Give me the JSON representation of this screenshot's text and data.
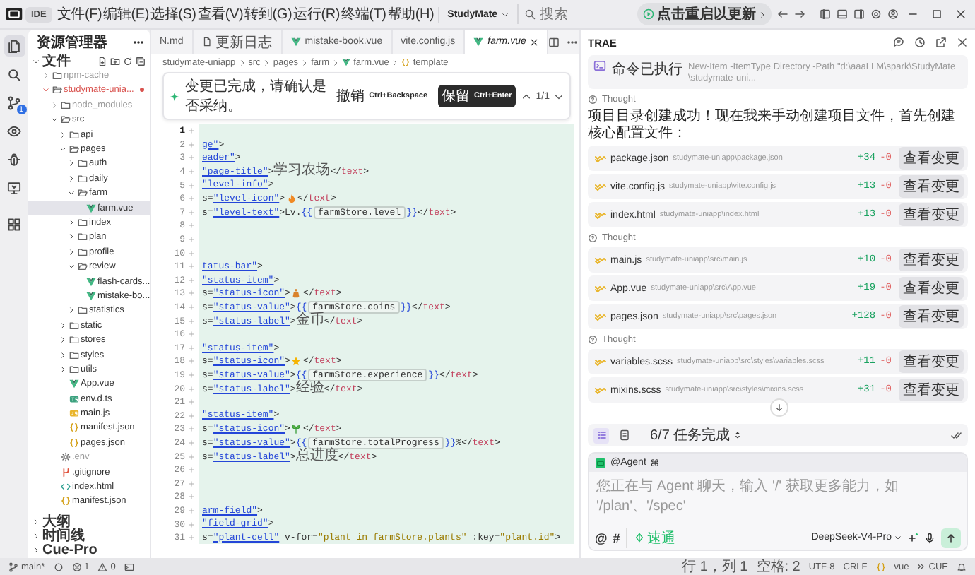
{
  "titlebar": {
    "ide_label": "IDE",
    "menus": [
      "文件(F)",
      "编辑(E)",
      "选择(S)",
      "查看(V)",
      "转到(G)",
      "运行(R)",
      "终端(T)",
      "帮助(H)"
    ],
    "project": "StudyMate",
    "search": {
      "placeholder": "搜索"
    },
    "update_button": "点击重启以更新"
  },
  "activity_bar": [
    {
      "kind": "files",
      "selected": true
    },
    {
      "kind": "search",
      "selected": false
    },
    {
      "kind": "source-control",
      "selected": false,
      "badge": "1"
    },
    {
      "kind": "preview",
      "selected": false
    },
    {
      "kind": "debug",
      "selected": false
    },
    {
      "kind": "remote",
      "selected": false
    },
    {
      "kind": "extensions",
      "selected": false
    }
  ],
  "explorer": {
    "title": "资源管理器",
    "section": {
      "label": "文件",
      "expanded": true
    },
    "tree": [
      {
        "label": "npm-cache",
        "kind": "folder",
        "expanded": false,
        "selected": false,
        "modified": false,
        "color": "#9a9a9a"
      },
      {
        "label": "studymate-unia...",
        "kind": "folder",
        "expanded": true,
        "selected": false,
        "modified": true,
        "color": "#d9534f",
        "children": [
          {
            "label": "node_modules",
            "kind": "folder",
            "expanded": false,
            "selected": false,
            "color": "#9a9a9a"
          },
          {
            "label": "src",
            "kind": "folder",
            "expanded": true,
            "selected": false,
            "children": [
              {
                "label": "api",
                "kind": "folder",
                "expanded": false,
                "selected": false
              },
              {
                "label": "pages",
                "kind": "folder",
                "expanded": true,
                "selected": false,
                "children": [
                  {
                    "label": "auth",
                    "kind": "folder",
                    "expanded": false,
                    "selected": false
                  },
                  {
                    "label": "daily",
                    "kind": "folder",
                    "expanded": false,
                    "selected": false
                  },
                  {
                    "label": "farm",
                    "kind": "folder",
                    "expanded": true,
                    "selected": false,
                    "children": [
                      {
                        "label": "farm.vue",
                        "kind": "vue",
                        "selected": true
                      }
                    ]
                  },
                  {
                    "label": "index",
                    "kind": "folder",
                    "expanded": false,
                    "selected": false
                  },
                  {
                    "label": "plan",
                    "kind": "folder",
                    "expanded": false,
                    "selected": false
                  },
                  {
                    "label": "profile",
                    "kind": "folder",
                    "expanded": false,
                    "selected": false
                  },
                  {
                    "label": "review",
                    "kind": "folder",
                    "expanded": true,
                    "selected": false,
                    "children": [
                      {
                        "label": "flash-cards...",
                        "kind": "vue",
                        "selected": false
                      },
                      {
                        "label": "mistake-bo...",
                        "kind": "vue",
                        "selected": false
                      }
                    ]
                  },
                  {
                    "label": "statistics",
                    "kind": "folder",
                    "expanded": false,
                    "selected": false
                  }
                ]
              },
              {
                "label": "static",
                "kind": "folder",
                "expanded": false,
                "selected": false
              },
              {
                "label": "stores",
                "kind": "folder",
                "expanded": false,
                "selected": false
              },
              {
                "label": "styles",
                "kind": "folder",
                "expanded": false,
                "selected": false
              },
              {
                "label": "utils",
                "kind": "folder",
                "expanded": false,
                "selected": false
              },
              {
                "label": "App.vue",
                "kind": "vue",
                "selected": false
              },
              {
                "label": "env.d.ts",
                "kind": "ts",
                "selected": false
              },
              {
                "label": "main.js",
                "kind": "js",
                "selected": false
              },
              {
                "label": "manifest.json",
                "kind": "json",
                "selected": false
              },
              {
                "label": "pages.json",
                "kind": "json",
                "selected": false
              }
            ]
          },
          {
            "label": ".env",
            "kind": "env",
            "selected": false,
            "color": "#9a9a9a"
          },
          {
            "label": ".gitignore",
            "kind": "git",
            "selected": false
          },
          {
            "label": "index.html",
            "kind": "html",
            "selected": false
          },
          {
            "label": "manifest.json",
            "kind": "json",
            "selected": false
          }
        ]
      }
    ],
    "panels": [
      {
        "label": "大纲",
        "expanded": false
      },
      {
        "label": "时间线",
        "expanded": false
      },
      {
        "label": "Cue-Pro",
        "expanded": false
      }
    ]
  },
  "editor": {
    "tabs": [
      {
        "label": "N.md",
        "kind": "partial",
        "selected": false
      },
      {
        "label": "更新日志",
        "kind": "doc",
        "selected": false
      },
      {
        "label": "mistake-book.vue",
        "kind": "vue",
        "selected": false
      },
      {
        "label": "vite.config.js",
        "kind": "plain",
        "selected": false
      },
      {
        "label": "farm.vue",
        "kind": "vue",
        "selected": true
      }
    ],
    "breadcrumb": [
      {
        "label": "studymate-uniapp",
        "kind": "folder"
      },
      {
        "label": "src",
        "kind": "folder"
      },
      {
        "label": "pages",
        "kind": "folder"
      },
      {
        "label": "farm",
        "kind": "folder"
      },
      {
        "label": "farm.vue",
        "kind": "vue"
      },
      {
        "label": "template",
        "kind": "braces"
      }
    ],
    "review_bar": {
      "message": "变更已完成，请确认是否采纳。",
      "undo": {
        "label": "撤销",
        "shortcut": "Ctrl+Backspace"
      },
      "keep": {
        "label": "保留",
        "shortcut": "Ctrl+Enter"
      },
      "counter": "1/1"
    },
    "lines": [
      {
        "n": "1",
        "current": true
      },
      {
        "n": "2",
        "current": false,
        "tokens": [
          {
            "kind": "attr",
            "text": "ge\""
          },
          {
            "kind": "plain",
            "text": ">"
          }
        ]
      },
      {
        "n": "3",
        "current": false,
        "tokens": [
          {
            "kind": "attr",
            "text": "eader\""
          },
          {
            "kind": "plain",
            "text": ">"
          }
        ]
      },
      {
        "n": "4",
        "current": false,
        "tokens": [
          {
            "kind": "attr",
            "text": "\"page-title\""
          },
          {
            "kind": "plain",
            "text": ">"
          },
          {
            "kind": "text",
            "text": "学习农场"
          },
          {
            "kind": "plain",
            "text": "</"
          },
          {
            "kind": "tag",
            "text": "text"
          },
          {
            "kind": "plain",
            "text": ">"
          }
        ]
      },
      {
        "n": "5",
        "current": false,
        "tokens": [
          {
            "kind": "attr",
            "text": "\"level-info\""
          },
          {
            "kind": "plain",
            "text": ">"
          }
        ]
      },
      {
        "n": "6",
        "current": false,
        "tokens": [
          {
            "kind": "plain",
            "text": "s="
          },
          {
            "kind": "attr",
            "text": "\"level-icon\""
          },
          {
            "kind": "plain",
            "text": ">"
          },
          {
            "kind": "flame"
          },
          {
            "kind": "plain",
            "text": "</"
          },
          {
            "kind": "tag",
            "text": "text"
          },
          {
            "kind": "plain",
            "text": ">"
          }
        ]
      },
      {
        "n": "7",
        "current": false,
        "tokens": [
          {
            "kind": "plain",
            "text": "s="
          },
          {
            "kind": "attr",
            "text": "\"level-text\""
          },
          {
            "kind": "plain",
            "text": ">Lv."
          },
          {
            "kind": "brace",
            "text": "{{"
          },
          {
            "kind": "expr",
            "text": "farmStore.level"
          },
          {
            "kind": "brace",
            "text": "}}"
          },
          {
            "kind": "plain",
            "text": "</"
          },
          {
            "kind": "tag",
            "text": "text"
          },
          {
            "kind": "plain",
            "text": ">"
          }
        ]
      },
      {
        "n": "8",
        "current": false
      },
      {
        "n": "9",
        "current": false
      },
      {
        "n": "10",
        "current": false
      },
      {
        "n": "11",
        "current": false,
        "tokens": [
          {
            "kind": "attr",
            "text": "tatus-bar\""
          },
          {
            "kind": "plain",
            "text": ">"
          }
        ]
      },
      {
        "n": "12",
        "current": false,
        "tokens": [
          {
            "kind": "attr",
            "text": "\"status-item\""
          },
          {
            "kind": "plain",
            "text": ">"
          }
        ]
      },
      {
        "n": "13",
        "current": false,
        "tokens": [
          {
            "kind": "plain",
            "text": "s="
          },
          {
            "kind": "attr",
            "text": "\"status-icon\""
          },
          {
            "kind": "plain",
            "text": ">"
          },
          {
            "kind": "bag"
          },
          {
            "kind": "plain",
            "text": "</"
          },
          {
            "kind": "tag",
            "text": "text"
          },
          {
            "kind": "plain",
            "text": ">"
          }
        ]
      },
      {
        "n": "14",
        "current": false,
        "tokens": [
          {
            "kind": "plain",
            "text": "s="
          },
          {
            "kind": "attr",
            "text": "\"status-value\""
          },
          {
            "kind": "plain",
            "text": ">"
          },
          {
            "kind": "brace",
            "text": "{{"
          },
          {
            "kind": "expr",
            "text": "farmStore.coins"
          },
          {
            "kind": "brace",
            "text": "}}"
          },
          {
            "kind": "plain",
            "text": "</"
          },
          {
            "kind": "tag",
            "text": "text"
          },
          {
            "kind": "plain",
            "text": ">"
          }
        ]
      },
      {
        "n": "15",
        "current": false,
        "tokens": [
          {
            "kind": "plain",
            "text": "s="
          },
          {
            "kind": "attr",
            "text": "\"status-label\""
          },
          {
            "kind": "plain",
            "text": ">"
          },
          {
            "kind": "text",
            "text": "金币"
          },
          {
            "kind": "plain",
            "text": "</"
          },
          {
            "kind": "tag",
            "text": "text"
          },
          {
            "kind": "plain",
            "text": ">"
          }
        ]
      },
      {
        "n": "16",
        "current": false
      },
      {
        "n": "17",
        "current": false,
        "tokens": [
          {
            "kind": "attr",
            "text": "\"status-item\""
          },
          {
            "kind": "plain",
            "text": ">"
          }
        ]
      },
      {
        "n": "18",
        "current": false,
        "tokens": [
          {
            "kind": "plain",
            "text": "s="
          },
          {
            "kind": "attr",
            "text": "\"status-icon\""
          },
          {
            "kind": "plain",
            "text": ">"
          },
          {
            "kind": "star"
          },
          {
            "kind": "plain",
            "text": "</"
          },
          {
            "kind": "tag",
            "text": "text"
          },
          {
            "kind": "plain",
            "text": ">"
          }
        ]
      },
      {
        "n": "19",
        "current": false,
        "tokens": [
          {
            "kind": "plain",
            "text": "s="
          },
          {
            "kind": "attr",
            "text": "\"status-value\""
          },
          {
            "kind": "plain",
            "text": ">"
          },
          {
            "kind": "brace",
            "text": "{{"
          },
          {
            "kind": "expr",
            "text": "farmStore.experience"
          },
          {
            "kind": "brace",
            "text": "}}"
          },
          {
            "kind": "plain",
            "text": "</"
          },
          {
            "kind": "tag",
            "text": "text"
          },
          {
            "kind": "plain",
            "text": ">"
          }
        ]
      },
      {
        "n": "20",
        "current": false,
        "tokens": [
          {
            "kind": "plain",
            "text": "s="
          },
          {
            "kind": "attr",
            "text": "\"status-label\""
          },
          {
            "kind": "plain",
            "text": ">"
          },
          {
            "kind": "text",
            "text": "经验"
          },
          {
            "kind": "plain",
            "text": "</"
          },
          {
            "kind": "tag",
            "text": "text"
          },
          {
            "kind": "plain",
            "text": ">"
          }
        ]
      },
      {
        "n": "21",
        "current": false
      },
      {
        "n": "22",
        "current": false,
        "tokens": [
          {
            "kind": "attr",
            "text": "\"status-item\""
          },
          {
            "kind": "plain",
            "text": ">"
          }
        ]
      },
      {
        "n": "23",
        "current": false,
        "tokens": [
          {
            "kind": "plain",
            "text": "s="
          },
          {
            "kind": "attr",
            "text": "\"status-icon\""
          },
          {
            "kind": "plain",
            "text": ">"
          },
          {
            "kind": "sprout"
          },
          {
            "kind": "plain",
            "text": "</"
          },
          {
            "kind": "tag",
            "text": "text"
          },
          {
            "kind": "plain",
            "text": ">"
          }
        ]
      },
      {
        "n": "24",
        "current": false,
        "tokens": [
          {
            "kind": "plain",
            "text": "s="
          },
          {
            "kind": "attr",
            "text": "\"status-value\""
          },
          {
            "kind": "plain",
            "text": ">"
          },
          {
            "kind": "brace",
            "text": "{{"
          },
          {
            "kind": "expr",
            "text": "farmStore.totalProgress"
          },
          {
            "kind": "brace",
            "text": "}}"
          },
          {
            "kind": "plain",
            "text": "%</"
          },
          {
            "kind": "tag",
            "text": "text"
          },
          {
            "kind": "plain",
            "text": ">"
          }
        ]
      },
      {
        "n": "25",
        "current": false,
        "tokens": [
          {
            "kind": "plain",
            "text": "s="
          },
          {
            "kind": "attr",
            "text": "\"status-label\""
          },
          {
            "kind": "plain",
            "text": ">"
          },
          {
            "kind": "text",
            "text": "总进度"
          },
          {
            "kind": "plain",
            "text": "</"
          },
          {
            "kind": "tag",
            "text": "text"
          },
          {
            "kind": "plain",
            "text": ">"
          }
        ]
      },
      {
        "n": "26",
        "current": false
      },
      {
        "n": "27",
        "current": false
      },
      {
        "n": "28",
        "current": false
      },
      {
        "n": "29",
        "current": false,
        "tokens": [
          {
            "kind": "attr",
            "text": "arm-field\""
          },
          {
            "kind": "plain",
            "text": ">"
          }
        ]
      },
      {
        "n": "30",
        "current": false,
        "tokens": [
          {
            "kind": "attr",
            "text": "\"field-grid\""
          },
          {
            "kind": "plain",
            "text": ">"
          }
        ]
      },
      {
        "n": "31",
        "current": false,
        "tokens": [
          {
            "kind": "plain",
            "text": "s="
          },
          {
            "kind": "attr",
            "text": "\"plant-cell\""
          },
          {
            "kind": "plain",
            "text": " v-for="
          },
          {
            "kind": "dir",
            "text": "\"plant in farmStore.plants\""
          },
          {
            "kind": "plain",
            "text": " :key="
          },
          {
            "kind": "dir",
            "text": "\"plant.id\""
          },
          {
            "kind": "plain",
            "text": ">"
          }
        ]
      }
    ]
  },
  "assistant": {
    "title": "TRAE",
    "feed": [
      {
        "kind": "command",
        "label": "命令已执行",
        "text": "New-Item -ItemType Directory -Path \"d:\\aaaLLM\\spark\\StudyMate\\studymate-uni..."
      },
      {
        "kind": "thought",
        "text": "Thought"
      },
      {
        "kind": "message",
        "text": "项目目录创建成功！现在我来手动创建项目文件，首先创建核心配置文件："
      },
      {
        "kind": "file",
        "name": "package.json",
        "path": "studymate-uniapp\\package.json",
        "added": "+34",
        "removed": "-0",
        "action": "查看变更"
      },
      {
        "kind": "file",
        "name": "vite.config.js",
        "path": "studymate-uniapp\\vite.config.js",
        "added": "+13",
        "removed": "-0",
        "action": "查看变更"
      },
      {
        "kind": "file",
        "name": "index.html",
        "path": "studymate-uniapp\\index.html",
        "added": "+13",
        "removed": "-0",
        "action": "查看变更"
      },
      {
        "kind": "thought",
        "text": "Thought"
      },
      {
        "kind": "file",
        "name": "main.js",
        "path": "studymate-uniapp\\src\\main.js",
        "added": "+10",
        "removed": "-0",
        "action": "查看变更"
      },
      {
        "kind": "file",
        "name": "App.vue",
        "path": "studymate-uniapp\\src\\App.vue",
        "added": "+19",
        "removed": "-0",
        "action": "查看变更"
      },
      {
        "kind": "file",
        "name": "pages.json",
        "path": "studymate-uniapp\\src\\pages.json",
        "added": "+128",
        "removed": "-0",
        "action": "查看变更"
      },
      {
        "kind": "thought",
        "text": "Thought"
      },
      {
        "kind": "file",
        "name": "variables.scss",
        "path": "studymate-uniapp\\src\\styles\\variables.scss",
        "added": "+11",
        "removed": "-0",
        "action": "查看变更"
      },
      {
        "kind": "file",
        "name": "mixins.scss",
        "path": "studymate-uniapp\\src\\styles\\mixins.scss",
        "added": "+31",
        "removed": "-0",
        "action": "查看变更"
      }
    ],
    "task_toggles": [
      {
        "kind": "list",
        "selected": true
      },
      {
        "kind": "file",
        "selected": false
      }
    ],
    "tasks": {
      "label": "6/7 任务完成",
      "expanded": false
    },
    "composer": {
      "agent": "@Agent",
      "shortcut": "⌘",
      "placeholder": "您正在与 Agent 聊天，输入 '/' 获取更多能力，如 '/plan'、'/spec'",
      "mention": "@",
      "topic": "#",
      "mode": "速通",
      "model": "DeepSeek-V4-Pro"
    }
  },
  "status_bar": {
    "branch": "main*",
    "errors": "1",
    "warnings": "0",
    "position": "行 1，列 1",
    "indent": "空格: 2",
    "encoding": "UTF-8",
    "eol": "CRLF",
    "language": "vue",
    "cue": "CUE"
  }
}
